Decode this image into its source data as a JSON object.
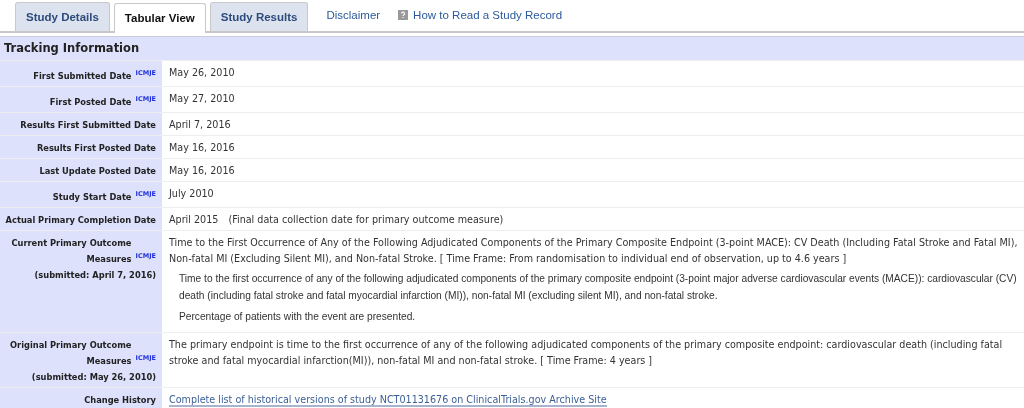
{
  "tabs": [
    {
      "label": "Study Details",
      "selected": false
    },
    {
      "label": "Tabular View",
      "selected": true
    },
    {
      "label": "Study Results",
      "selected": false
    }
  ],
  "links": [
    {
      "label": "Disclaimer",
      "help_icon": false
    },
    {
      "label": "How to Read a Study Record",
      "help_icon": true
    }
  ],
  "section": {
    "title": "Tracking Information"
  },
  "rows": [
    {
      "kind": "text",
      "label": "First Submitted Date",
      "icmje": "ICMJE",
      "value": "May 26, 2010"
    },
    {
      "kind": "text",
      "label": "First Posted Date",
      "icmje": "ICMJE",
      "value": "May 27, 2010"
    },
    {
      "kind": "text",
      "label": "Results First Submitted Date",
      "value": "April 7, 2016"
    },
    {
      "kind": "text",
      "label": "Results First Posted Date",
      "value": "May 16, 2016"
    },
    {
      "kind": "text",
      "label": "Last Update Posted Date",
      "value": "May 16, 2016"
    },
    {
      "kind": "text",
      "label": "Study Start Date",
      "icmje": "ICMJE",
      "value": "July 2010"
    },
    {
      "kind": "text",
      "label": "Actual Primary Completion Date",
      "value": "April 2015",
      "note": "(Final data collection date for primary outcome measure)"
    },
    {
      "kind": "outcome",
      "label": "Current Primary Outcome Measures",
      "icmje": "ICMJE",
      "submitted": "(submitted: April 7, 2016)",
      "value": "Time to the First Occurrence of Any of the Following Adjudicated Components of the Primary Composite Endpoint (3-point MACE): CV Death (Including Fatal Stroke and Fatal MI), Non-fatal MI (Excluding Silent MI), and Non-fatal Stroke. [ Time Frame: From randomisation to individual end of observation, up to 4.6 years ]",
      "description": [
        "Time to the first occurrence of any of the following adjudicated components of the primary composite endpoint (3-point major adverse cardiovascular events (MACE)): cardiovascular (CV) death (including fatal stroke and fatal myocardial infarction (MI)), non-fatal MI (excluding silent MI), and non-fatal stroke.",
        "Percentage of patients with the event are presented."
      ]
    },
    {
      "kind": "outcome",
      "label": "Original Primary Outcome Measures",
      "icmje": "ICMJE",
      "submitted": "(submitted: May 26, 2010)",
      "value": "The primary endpoint is time to the first occurrence of any of the following adjudicated components of the primary composite endpoint: cardiovascular death (including fatal stroke and fatal myocardial infarction(MI)), non-fatal MI and non-fatal stroke. [ Time Frame: 4 years ]"
    },
    {
      "kind": "link",
      "label": "Change History",
      "value": "Complete list of historical versions of study NCT01131676 on ClinicalTrials.gov Archive Site"
    }
  ]
}
